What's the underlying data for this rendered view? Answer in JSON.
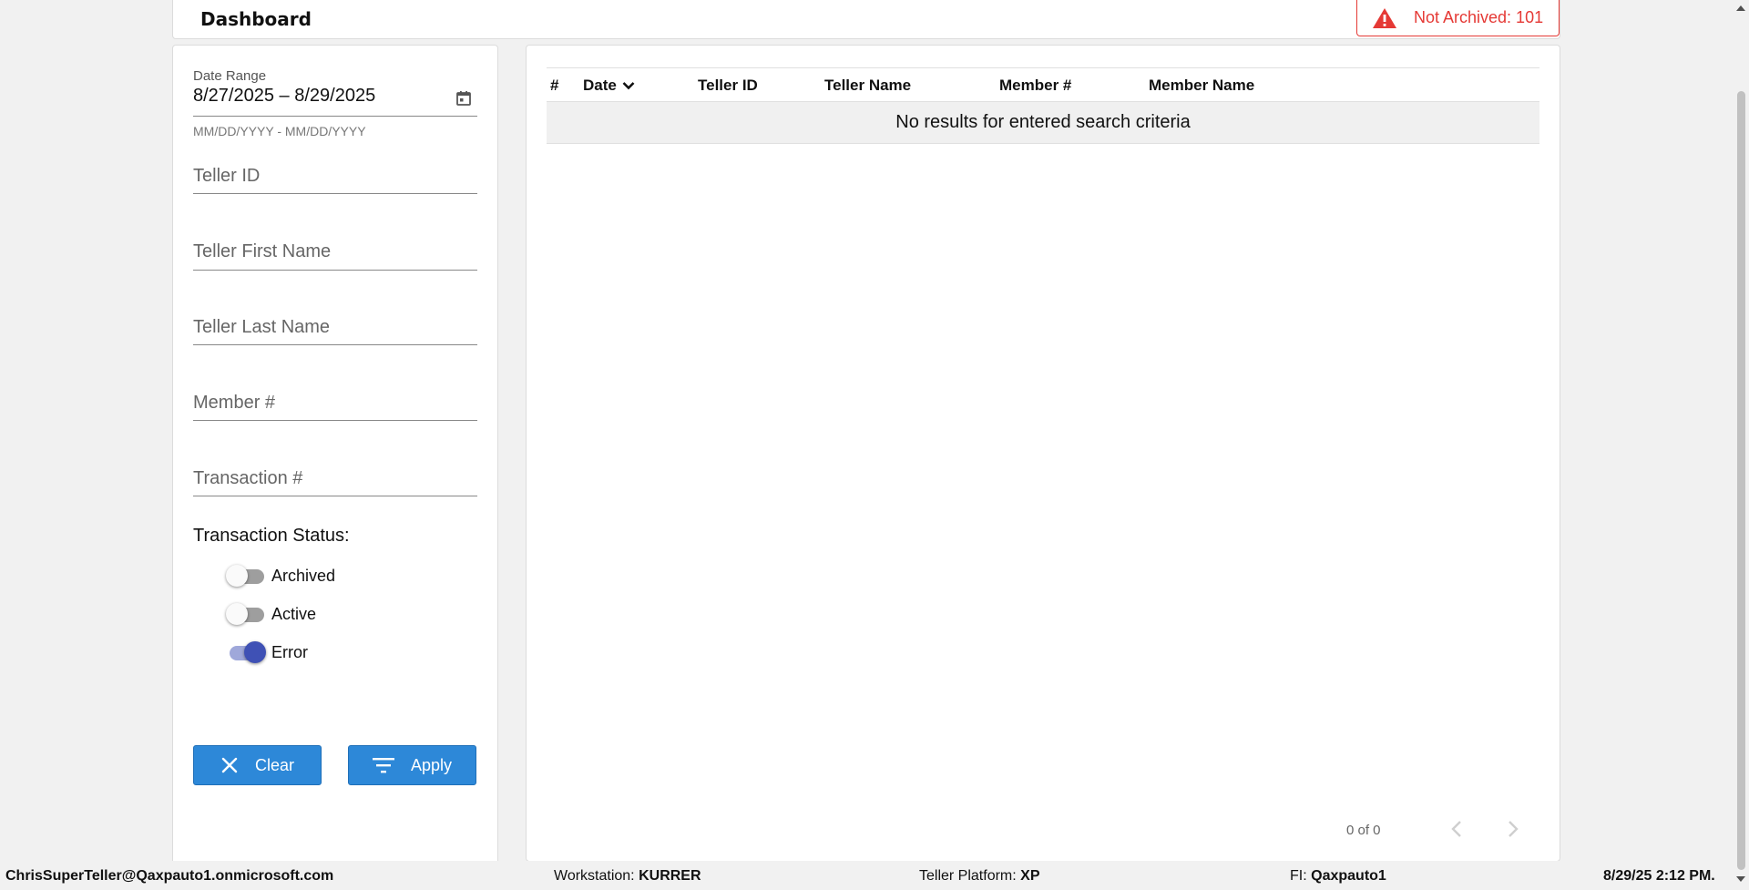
{
  "header": {
    "title": "Dashboard"
  },
  "alert": {
    "label": "Not Archived: 101",
    "icon": "warning-icon",
    "color": "#e53935"
  },
  "filters": {
    "date_range_label": "Date Range",
    "date_range_value": "8/27/2025 – 8/29/2025",
    "date_range_hint": "MM/DD/YYYY - MM/DD/YYYY",
    "teller_id_placeholder": "Teller ID",
    "teller_first_name_placeholder": "Teller First Name",
    "teller_last_name_placeholder": "Teller Last Name",
    "member_number_placeholder": "Member #",
    "transaction_number_placeholder": "Transaction #",
    "status_heading": "Transaction Status:",
    "statuses": [
      {
        "label": "Archived",
        "on": false
      },
      {
        "label": "Active",
        "on": false
      },
      {
        "label": "Error",
        "on": true
      }
    ],
    "clear_label": "Clear",
    "apply_label": "Apply"
  },
  "table": {
    "columns": [
      "#",
      "Date",
      "Teller ID",
      "Teller Name",
      "Member #",
      "Member Name"
    ],
    "sort_column": "Date",
    "empty_message": "No results for entered search criteria",
    "pager_text": "0 of 0"
  },
  "status_bar": {
    "user": "ChrisSuperTeller@Qaxpauto1.onmicrosoft.com",
    "workstation_label": "Workstation:",
    "workstation_value": "KURRER",
    "platform_label": "Teller Platform:",
    "platform_value": "XP",
    "fi_label": "FI:",
    "fi_value": "Qaxpauto1",
    "datetime": "8/29/25 2:12 PM."
  },
  "colors": {
    "accent_blue": "#2d88d8",
    "toggle_on": "#3f51b5",
    "alert_red": "#e53935"
  }
}
